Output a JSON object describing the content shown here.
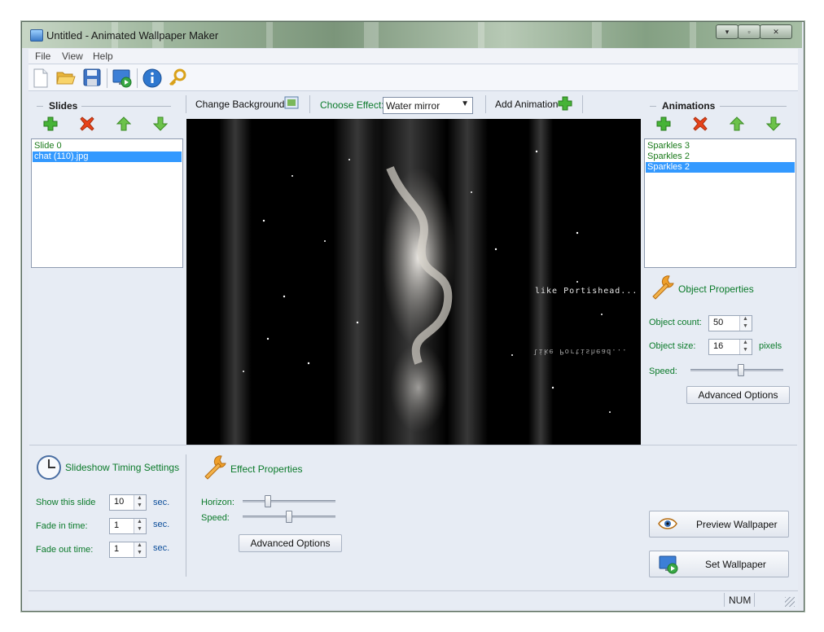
{
  "window": {
    "title": "Untitled - Animated Wallpaper Maker"
  },
  "menu": {
    "file": "File",
    "view": "View",
    "help": "Help"
  },
  "toolbar": {
    "icons": [
      "new-file-icon",
      "open-folder-icon",
      "save-disk-icon",
      "set-wallpaper-icon",
      "info-icon",
      "key-icon"
    ],
    "change_background_label": "Change Background",
    "choose_effect_label": "Choose Effect:",
    "effect_selected": "Water mirror",
    "add_animation_label": "Add Animation"
  },
  "slides": {
    "title": "Slides",
    "items": [
      {
        "label": "Slide 0",
        "selected": false
      },
      {
        "label": "chat (110).jpg",
        "selected": true
      }
    ]
  },
  "animations": {
    "title": "Animations",
    "items": [
      {
        "label": "Sparkles 3",
        "selected": false
      },
      {
        "label": "Sparkles 2",
        "selected": false
      },
      {
        "label": "Sparkles 2",
        "selected": true
      }
    ]
  },
  "preview": {
    "caption": "like Portishead...",
    "caption_reflection": "like Portishead..."
  },
  "object_properties": {
    "title": "Object Properties",
    "count_label": "Object count:",
    "count_value": "50",
    "size_label": "Object size:",
    "size_value": "16",
    "size_unit": "pixels",
    "speed_label": "Speed:",
    "speed_level": 0.55,
    "advanced_label": "Advanced Options"
  },
  "timing": {
    "title": "Slideshow Timing Settings",
    "show_label": "Show this slide",
    "show_value": "10",
    "fade_in_label": "Fade in time:",
    "fade_in_value": "1",
    "fade_out_label": "Fade out time:",
    "fade_out_value": "1",
    "unit": "sec."
  },
  "effect_properties": {
    "title": "Effect Properties",
    "horizon_label": "Horizon:",
    "horizon_level": 0.25,
    "speed_label": "Speed:",
    "speed_level": 0.5,
    "advanced_label": "Advanced Options"
  },
  "actions": {
    "preview_label": "Preview Wallpaper",
    "set_label": "Set Wallpaper"
  },
  "status": {
    "num": "NUM"
  },
  "colors": {
    "accent_green": "#0b8a2a",
    "selection": "#3399ff",
    "delete_red": "#e8421a"
  }
}
